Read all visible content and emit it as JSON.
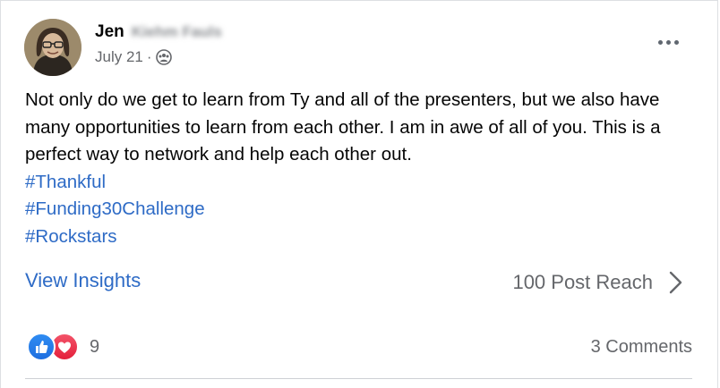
{
  "post": {
    "author_first": "Jen",
    "author_last": "Kiehm Fauls",
    "date": "July 21",
    "separator": "·",
    "audience_icon": "group-icon",
    "body": "Not only do we get to learn from Ty and all of the presenters, but we also have many opportunities to learn from each other. I am in awe of all of you. This is a perfect way to network and help each other out.",
    "hashtags": [
      "#Thankful",
      "#Funding30Challenge",
      "#Rockstars"
    ]
  },
  "insights": {
    "link_label": "View Insights",
    "reach_label": "100 Post Reach"
  },
  "footer": {
    "reaction_icons": [
      "like-icon",
      "love-icon"
    ],
    "reaction_count": "9",
    "comments_label": "3 Comments"
  },
  "colors": {
    "link": "#2e6bc6",
    "secondary_text": "#65676b",
    "like": "#1f6fe0",
    "love": "#e4203b"
  }
}
